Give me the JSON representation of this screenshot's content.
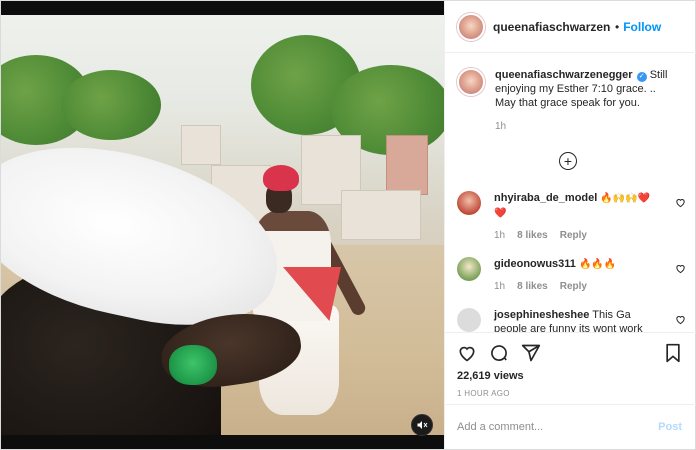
{
  "post": {
    "username": "queenafiaschwarzeneg",
    "follow_label": "Follow",
    "mute_icon": "speaker-muted-icon"
  },
  "caption": {
    "username": "queenafiaschwarzenegger",
    "text": "Still enjoying my Esther 7:10 grace. .. May that grace speak for you.",
    "time": "1h"
  },
  "comments": [
    {
      "username": "nhyiraba_de_model",
      "text": "🔥🙌🙌❤️ ❤️",
      "time": "1h",
      "likes": "8 likes",
      "reply": "Reply",
      "avatar_color": "#c04a3a"
    },
    {
      "username": "gideonowus311",
      "text": "🔥🔥🔥",
      "time": "1h",
      "likes": "8 likes",
      "reply": "Reply",
      "avatar_color": "#7aa15a"
    },
    {
      "username": "josephinesheshee",
      "text": "This Ga people are funny its wont work",
      "avatar_color": "#dcdcdc"
    }
  ],
  "stats": {
    "views": "22,619 views",
    "posted": "1 HOUR AGO"
  },
  "comment_box": {
    "placeholder": "Add a comment...",
    "post_label": "Post"
  },
  "colors": {
    "accent": "#0095f6",
    "post_disabled": "#b3dbff",
    "muted_text": "#8e8e8e"
  }
}
